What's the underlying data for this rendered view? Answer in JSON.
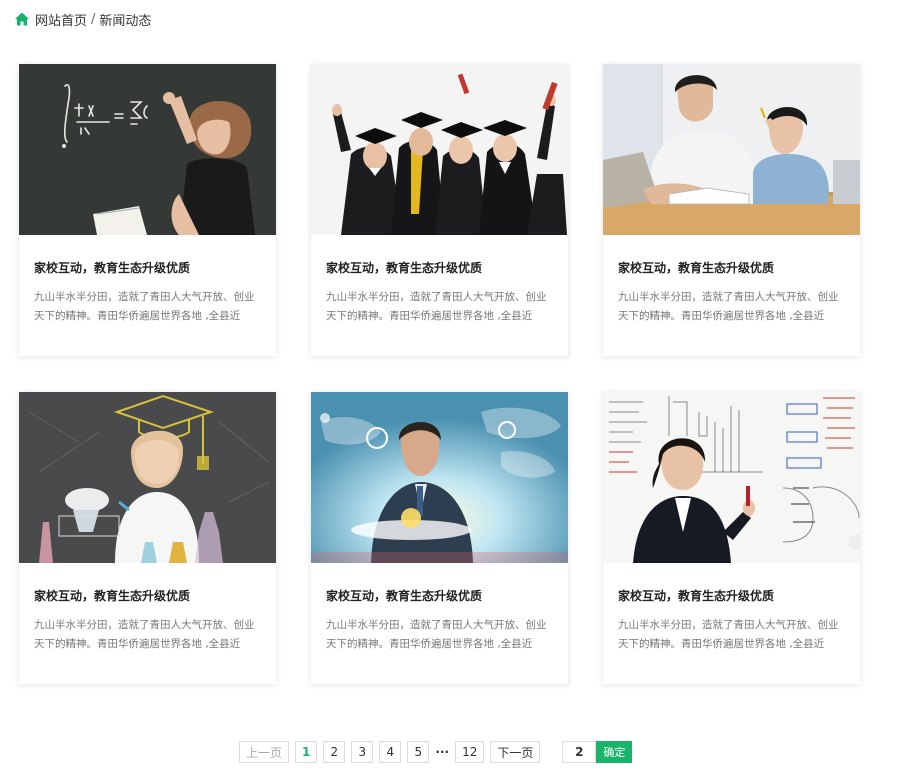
{
  "breadcrumb": {
    "home": "网站首页",
    "separator": "/",
    "current": "新闻动态"
  },
  "colors": {
    "accent": "#19b36b"
  },
  "cards": [
    {
      "image": "teacher-at-chalkboard",
      "title": "家校互动，教育生态升级优质",
      "desc": "九山半水半分田，造就了青田人大气开放、创业天下的精神。青田华侨遍居世界各地 ,全县近的...."
    },
    {
      "image": "graduates-celebrating",
      "title": "家校互动，教育生态升级优质",
      "desc": "九山半水半分田，造就了青田人大气开放、创业天下的精神。青田华侨遍居世界各地 ,全县近的...."
    },
    {
      "image": "father-tutoring-child",
      "title": "家校互动，教育生态升级优质",
      "desc": "九山半水半分田，造就了青田人大气开放、创业天下的精神。青田华侨遍居世界各地 ,全县近的...."
    },
    {
      "image": "girl-chemistry-experiment",
      "title": "家校互动，教育生态升级优质",
      "desc": "九山半水半分田，造就了青田人大气开放、创业天下的精神。青田华侨遍居世界各地 ,全县近的...."
    },
    {
      "image": "man-digital-world-map",
      "title": "家校互动，教育生态升级优质",
      "desc": "九山半水半分田，造就了青田人大气开放、创业天下的精神。青田华侨遍居世界各地 ,全县近的...."
    },
    {
      "image": "woman-at-whiteboard",
      "title": "家校互动，教育生态升级优质",
      "desc": "九山半水半分田，造就了青田人大气开放、创业天下的精神。青田华侨遍居世界各地 ,全县近的...."
    }
  ],
  "pagination": {
    "prev": "上一页",
    "pages": [
      "1",
      "2",
      "3",
      "4",
      "5"
    ],
    "ellipsis": "···",
    "last": "12",
    "next": "下一页",
    "jump_value": "2",
    "confirm": "确定",
    "current_page": "1"
  }
}
